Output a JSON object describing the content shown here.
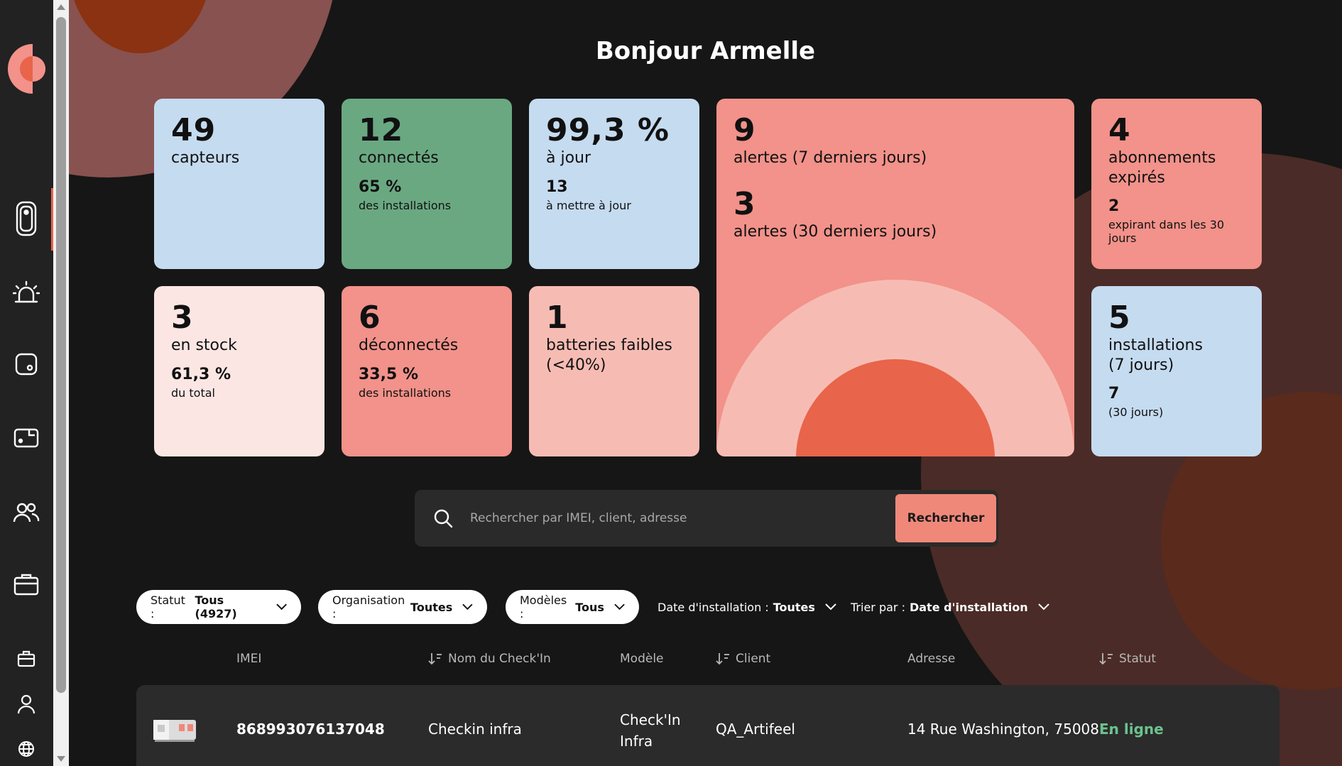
{
  "greeting": "Bonjour Armelle",
  "colors": {
    "accent": "#e8644a",
    "salmon": "#f2928a",
    "light_blue": "#c5dbf0",
    "green": "#6aa882",
    "pink_light": "#fbe6e4",
    "pink_mid": "#f6bcb4",
    "online": "#6cc28e"
  },
  "sidebar": {
    "items": [
      {
        "icon": "device-icon"
      },
      {
        "icon": "alarm-icon"
      },
      {
        "icon": "sensor-square-icon"
      },
      {
        "icon": "wallet-device-icon"
      },
      {
        "icon": "users-icon"
      },
      {
        "icon": "briefcase-icon"
      },
      {
        "icon": "small-briefcase-icon"
      },
      {
        "icon": "user-icon"
      },
      {
        "icon": "globe-icon"
      }
    ]
  },
  "stats": {
    "capteurs": {
      "value": "49",
      "label": "capteurs"
    },
    "connectes": {
      "value": "12",
      "label": "connectés",
      "sub_value": "65 %",
      "sub_label": "des installations"
    },
    "a_jour": {
      "value": "99,3 %",
      "label": "à jour",
      "sub_value": "13",
      "sub_label": "à mettre à jour"
    },
    "alertes": {
      "value7": "9",
      "label7": "alertes (7 derniers jours)",
      "value30": "3",
      "label30": "alertes (30 derniers jours)"
    },
    "abonnements": {
      "value": "4",
      "label": "abonnements expirés",
      "sub_value": "2",
      "sub_label": "expirant dans les 30 jours"
    },
    "stock": {
      "value": "3",
      "label": "en stock",
      "sub_value": "61,3 %",
      "sub_label": "du total"
    },
    "deconnectes": {
      "value": "6",
      "label": "déconnectés",
      "sub_value": "33,5 %",
      "sub_label": "des installations"
    },
    "batteries": {
      "value": "1",
      "label": "batteries faibles (<40%)"
    },
    "installations": {
      "value": "5",
      "label": "installations (7 jours)",
      "sub_value": "7",
      "sub_label": "(30 jours)"
    }
  },
  "search": {
    "placeholder": "Rechercher par IMEI, client, adresse",
    "button_label": "Rechercher"
  },
  "filters": {
    "statut": {
      "label": "Statut :",
      "value": "Tous (4927)"
    },
    "organisation": {
      "label": "Organisation :",
      "value": "Toutes"
    },
    "modeles": {
      "label": "Modèles :",
      "value": "Tous"
    },
    "date_installation": {
      "label": "Date d'installation :",
      "value": "Toutes"
    },
    "trier_par": {
      "label": "Trier par :",
      "value": "Date d'installation"
    }
  },
  "table": {
    "headers": {
      "imei": "IMEI",
      "nom": "Nom du Check'In",
      "modele": "Modèle",
      "client": "Client",
      "adresse": "Adresse",
      "statut": "Statut"
    },
    "rows": [
      {
        "imei": "868993076137048",
        "nom": "Checkin infra",
        "modele_line1": "Check'In",
        "modele_line2": "Infra",
        "client": "QA_Artifeel",
        "adresse": "14 Rue Washington, 75008...",
        "statut": "En ligne"
      }
    ]
  }
}
